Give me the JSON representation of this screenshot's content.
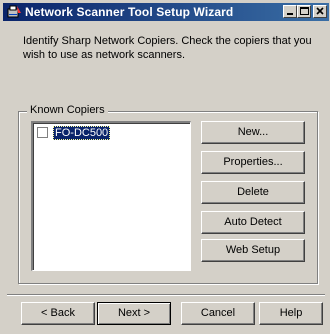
{
  "window": {
    "title": "Network Scanner Tool Setup Wizard",
    "icon": "app-icon",
    "controls": [
      "minimize-icon",
      "maximize-icon",
      "close-icon"
    ]
  },
  "instructions": "Identify Sharp Network Copiers. Check the copiers that you wish to use as network scanners.",
  "known_copiers": {
    "group_label": "Known Copiers",
    "items": [
      {
        "label": "FO-DC500",
        "checked": false,
        "selected": true
      }
    ]
  },
  "side_buttons": {
    "new": "New...",
    "properties": "Properties...",
    "delete": "Delete",
    "auto_detect": "Auto Detect",
    "web_setup": "Web Setup"
  },
  "nav_buttons": {
    "back": "< Back",
    "next": "Next >",
    "cancel": "Cancel",
    "help": "Help"
  },
  "colors": {
    "title_start": "#0a246a",
    "title_end": "#3a6ea5",
    "face": "#d4d0c8",
    "selection": "#0a246a"
  }
}
